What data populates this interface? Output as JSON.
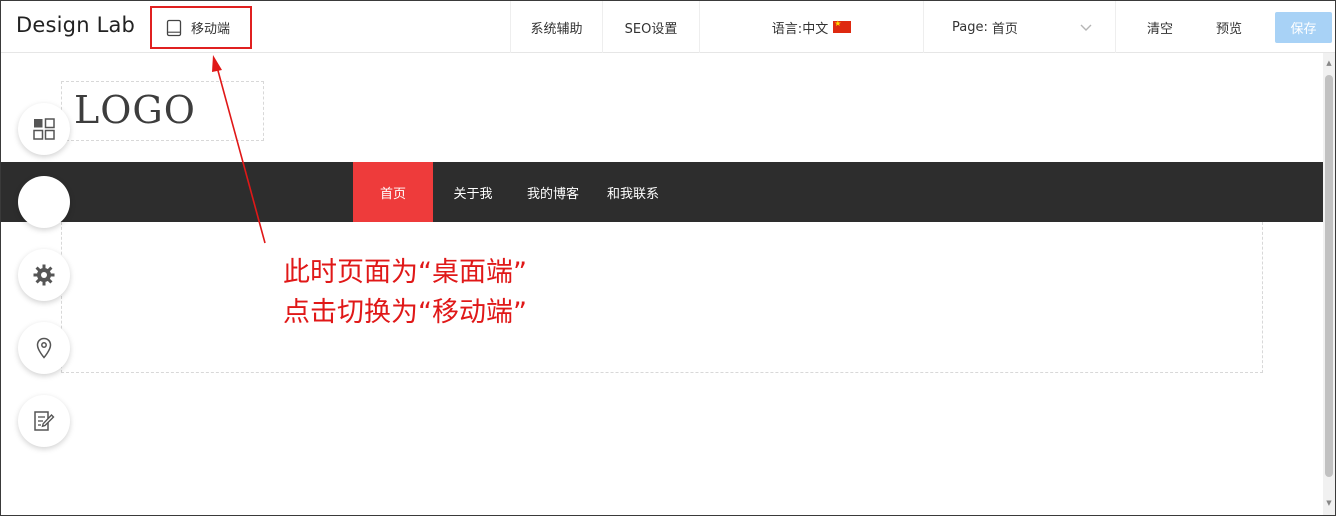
{
  "toolbar": {
    "brand": "Design Lab",
    "mode_switch_label": "移动端",
    "system_assist_label": "系统辅助",
    "seo_label": "SEO设置",
    "language_prefix": "语言:",
    "language_value": "中文",
    "page_prefix": "Page:",
    "page_value": "首页",
    "clear_label": "清空",
    "preview_label": "预览",
    "save_label": "保存"
  },
  "canvas": {
    "logo_text": "LOGO",
    "nav_items": [
      {
        "label": "首页",
        "active": true
      },
      {
        "label": "关于我",
        "active": false
      },
      {
        "label": "我的博客",
        "active": false
      },
      {
        "label": "和我联系",
        "active": false
      }
    ]
  },
  "side_tools": [
    {
      "icon": "grid-icon"
    },
    {
      "icon": "shirt-icon"
    },
    {
      "icon": "gear-icon"
    },
    {
      "icon": "location-pin-icon"
    },
    {
      "icon": "edit-document-icon"
    }
  ],
  "annotation": {
    "line1": "此时页面为“桌面端”",
    "line2": "点击切换为“移动端”"
  },
  "colors": {
    "accent_red": "#ee3b3b",
    "annotation_red": "#e01818",
    "navbar_bg": "#2d2d2d",
    "save_button_bg": "#a8d2f6"
  }
}
